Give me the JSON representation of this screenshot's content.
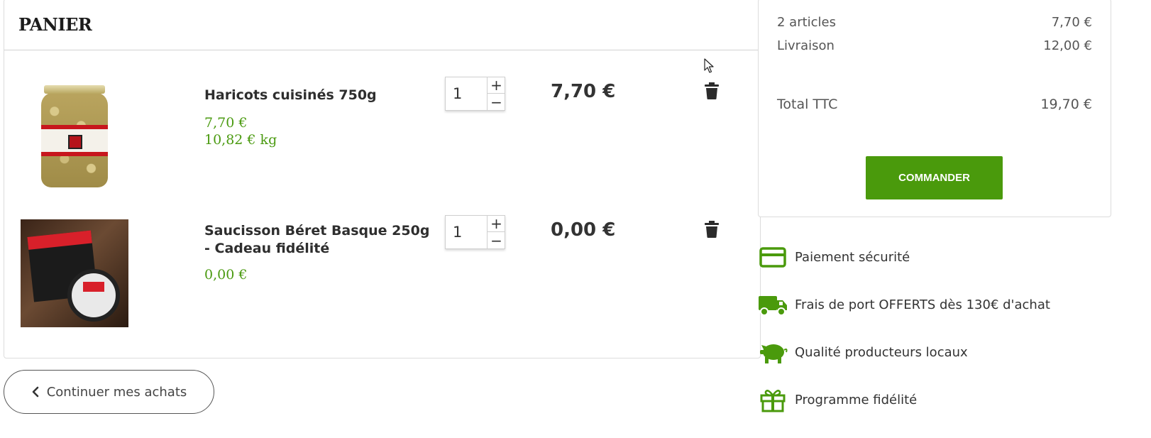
{
  "cart": {
    "title": "PANIER",
    "items": [
      {
        "name": "Haricots cuisinés 750g",
        "unit_price": "7,70 €",
        "kg_price": "10,82 € kg",
        "quantity": "1",
        "total": "7,70 €",
        "image_icon": "bean-jar-image"
      },
      {
        "name": "Saucisson Béret Basque 250g - Cadeau fidélité",
        "unit_price": "0,00 €",
        "quantity": "1",
        "total": "0,00 €",
        "image_icon": "saucisson-box-image"
      }
    ],
    "qty_plus": "+",
    "qty_minus": "−",
    "continue_label": "Continuer mes achats"
  },
  "summary": {
    "articles_label": "2 articles",
    "articles_value": "7,70 €",
    "shipping_label": "Livraison",
    "shipping_value": "12,00 €",
    "total_label": "Total TTC",
    "total_value": "19,70 €",
    "order_label": "COMMANDER"
  },
  "reassurance": [
    {
      "icon": "credit-card-icon",
      "label": "Paiement sécurité"
    },
    {
      "icon": "delivery-truck-icon",
      "label": "Frais de port OFFERTS dès 130€ d'achat"
    },
    {
      "icon": "pig-icon",
      "label": "Qualité producteurs locaux"
    },
    {
      "icon": "gift-icon",
      "label": "Programme fidélité"
    }
  ],
  "colors": {
    "accent_green": "#4a9a0c",
    "price_green": "#4a9a10",
    "text_dark": "#333333",
    "border": "#dcdcdc"
  }
}
